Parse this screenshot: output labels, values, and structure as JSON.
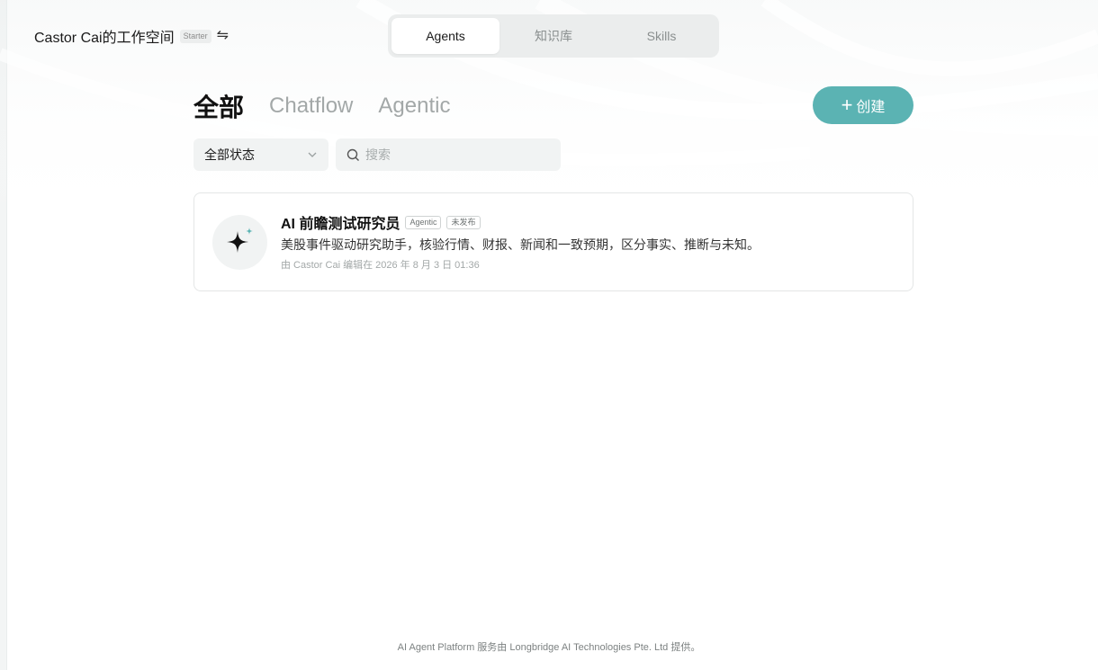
{
  "header": {
    "workspace_name": "Castor Cai的工作空间",
    "plan_badge": "Starter",
    "switch_icon": "⇋",
    "tabs": [
      {
        "label": "Agents",
        "active": true
      },
      {
        "label": "知识库",
        "active": false
      },
      {
        "label": "Skills",
        "active": false
      }
    ]
  },
  "categories": [
    {
      "label": "全部",
      "active": true
    },
    {
      "label": "Chatflow",
      "active": false
    },
    {
      "label": "Agentic",
      "active": false
    }
  ],
  "create_button": {
    "icon": "+",
    "label": "创建"
  },
  "filters": {
    "status_value": "全部状态",
    "search_placeholder": "搜索"
  },
  "agents": [
    {
      "title": "AI 前瞻测试研究员",
      "tags": [
        "Agentic",
        "未发布"
      ],
      "description": "美股事件驱动研究助手，核验行情、财报、新闻和一致预期，区分事实、推断与未知。",
      "meta": "由 Castor Cai 编辑在 2026 年 8 月 3 日 01:36",
      "icon": "sparkle-icon"
    }
  ],
  "footer": "AI Agent Platform 服务由 Longbridge AI Technologies Pte. Ltd 提供。",
  "colors": {
    "accent": "#5bb3b3",
    "sparkle_accent": "#5bb3b3"
  }
}
